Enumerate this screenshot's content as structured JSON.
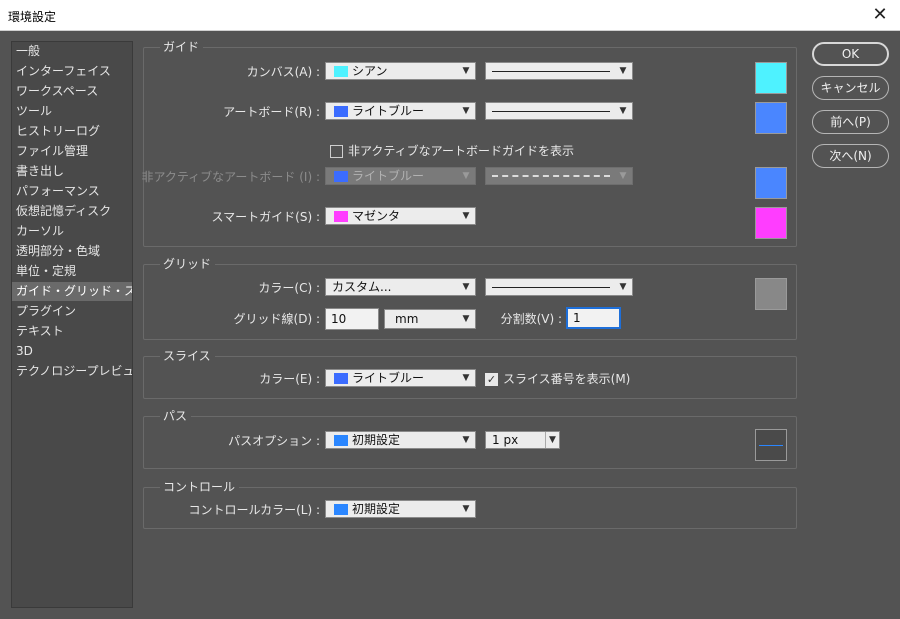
{
  "window": {
    "title": "環境設定",
    "close_glyph": "✕"
  },
  "sidebar": {
    "items": [
      {
        "label": "一般"
      },
      {
        "label": "インターフェイス"
      },
      {
        "label": "ワークスペース"
      },
      {
        "label": "ツール"
      },
      {
        "label": "ヒストリーログ"
      },
      {
        "label": "ファイル管理"
      },
      {
        "label": "書き出し"
      },
      {
        "label": "パフォーマンス"
      },
      {
        "label": "仮想記憶ディスク"
      },
      {
        "label": "カーソル"
      },
      {
        "label": "透明部分・色域"
      },
      {
        "label": "単位・定規"
      },
      {
        "label": "ガイド・グリッド・スライス",
        "active": true
      },
      {
        "label": "プラグイン"
      },
      {
        "label": "テキスト"
      },
      {
        "label": "3D"
      },
      {
        "label": "テクノロジープレビュー"
      }
    ]
  },
  "guides": {
    "title": "ガイド",
    "canvas": {
      "label": "カンバス(A) :",
      "color_name": "シアン",
      "color": "#4ef2ff"
    },
    "artboard": {
      "label": "アートボード(R) :",
      "color_name": "ライトブルー",
      "color": "#3b6cff",
      "swatch": "#4a86ff"
    },
    "show_inactive": {
      "label": "非アクティブなアートボードガイドを表示",
      "checked": false
    },
    "inactive_artboard": {
      "label": "非アクティブなアートボード (I) :",
      "color_name": "ライトブルー",
      "color": "#3b6cff",
      "swatch": "#4a86ff"
    },
    "smart": {
      "label": "スマートガイド(S) :",
      "color_name": "マゼンタ",
      "color": "#ff3dff"
    }
  },
  "grid": {
    "title": "グリッド",
    "color": {
      "label": "カラー(C) :",
      "value": "カスタム...",
      "swatch": "#888888"
    },
    "gridline": {
      "label": "グリッド線(D) :",
      "value": "10",
      "unit": "mm"
    },
    "subdivisions": {
      "label": "分割数(V) :",
      "value": "1"
    }
  },
  "slices": {
    "title": "スライス",
    "color": {
      "label": "カラー(E) :",
      "color_name": "ライトブルー",
      "color": "#3b6cff"
    },
    "show_numbers": {
      "label": "スライス番号を表示(M)",
      "checked": true
    }
  },
  "path": {
    "title": "パス",
    "options": {
      "label": "パスオプション :",
      "color_name": "初期設定",
      "color": "#2a86ff",
      "width": "1 px"
    }
  },
  "control": {
    "title": "コントロール",
    "color": {
      "label": "コントロールカラー(L) :",
      "color_name": "初期設定",
      "color": "#2a86ff"
    }
  },
  "buttons": {
    "ok": "OK",
    "cancel": "キャンセル",
    "prev": "前へ(P)",
    "next": "次へ(N)"
  }
}
